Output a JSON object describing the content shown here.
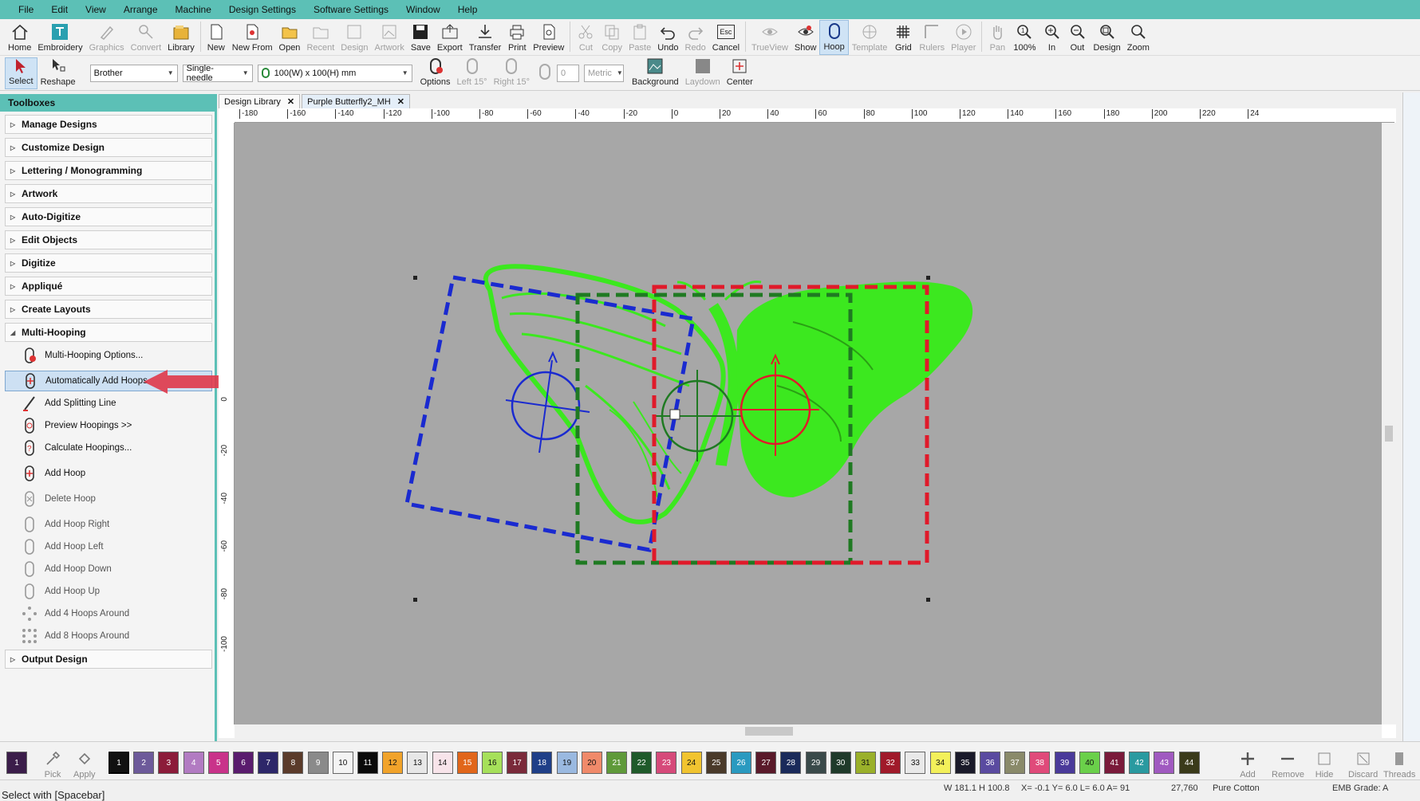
{
  "menu": [
    "File",
    "Edit",
    "View",
    "Arrange",
    "Machine",
    "Design Settings",
    "Software Settings",
    "Window",
    "Help"
  ],
  "toolbar1": {
    "home": "Home",
    "embroidery": "Embroidery",
    "graphics": "Graphics",
    "convert": "Convert",
    "library": "Library",
    "new": "New",
    "new_from": "New From",
    "open": "Open",
    "recent": "Recent",
    "design": "Design",
    "artwork": "Artwork",
    "save": "Save",
    "export": "Export",
    "transfer": "Transfer",
    "print": "Print",
    "preview": "Preview",
    "cut": "Cut",
    "copy": "Copy",
    "paste": "Paste",
    "undo": "Undo",
    "redo": "Redo",
    "cancel": "Cancel",
    "esc": "Esc",
    "trueview": "TrueView",
    "show": "Show",
    "hoop": "Hoop",
    "template": "Template",
    "grid": "Grid",
    "rulers": "Rulers",
    "player": "Player",
    "pan": "Pan",
    "zoom100": "100%",
    "zoom_in": "In",
    "zoom_out": "Out",
    "zoom_design": "Design",
    "zoom": "Zoom"
  },
  "toolbar2": {
    "select": "Select",
    "reshape": "Reshape",
    "machine_brand": "Brother",
    "needle": "Single-needle",
    "hoop_size": "100(W) x 100(H) mm",
    "options": "Options",
    "left15": "Left 15°",
    "right15": "Right 15°",
    "angle_value": "0",
    "units": "Metric",
    "background": "Background",
    "laydown": "Laydown",
    "center": "Center"
  },
  "toolboxes": {
    "title": "Toolboxes",
    "sections": [
      "Manage Designs",
      "Customize Design",
      "Lettering / Monogramming",
      "Artwork",
      "Auto-Digitize",
      "Edit Objects",
      "Digitize",
      "Appliqué",
      "Create Layouts",
      "Multi-Hooping"
    ],
    "multi_hooping_tools": [
      "Multi-Hooping Options...",
      "Automatically Add Hoops",
      "Add Splitting Line",
      "Preview Hoopings >>",
      "Calculate Hoopings...",
      "Add Hoop",
      "Delete Hoop",
      "Add Hoop Right",
      "Add Hoop Left",
      "Add Hoop Down",
      "Add Hoop Up",
      "Add 4 Hoops Around",
      "Add 8 Hoops Around"
    ],
    "output_section": "Output Design"
  },
  "doc_tabs": [
    {
      "label": "Design Library"
    },
    {
      "label": "Purple Butterfly2_MH"
    }
  ],
  "ruler_top_labels": [
    "-180",
    "-160",
    "-140",
    "-120",
    "-100",
    "-80",
    "-60",
    "-40",
    "-20",
    "0",
    "20",
    "40",
    "60",
    "80",
    "100",
    "120",
    "140",
    "160",
    "180",
    "200",
    "220",
    "24"
  ],
  "ruler_left_labels": [
    "0",
    "-20",
    "-40",
    "-60",
    "-80",
    "-100"
  ],
  "palette": {
    "pick": "Pick",
    "apply": "Apply",
    "swatches": [
      {
        "n": "1",
        "c": "#3b1d4a"
      },
      {
        "n": "1",
        "c": "#111111"
      },
      {
        "n": "2",
        "c": "#6d5a9a"
      },
      {
        "n": "3",
        "c": "#8c1c3a"
      },
      {
        "n": "4",
        "c": "#b27bc2"
      },
      {
        "n": "5",
        "c": "#c9338a"
      },
      {
        "n": "6",
        "c": "#5a1c6e"
      },
      {
        "n": "7",
        "c": "#2d2769"
      },
      {
        "n": "8",
        "c": "#5b3b2a"
      },
      {
        "n": "9",
        "c": "#8a8a8a"
      },
      {
        "n": "10",
        "c": "#f4f4f4"
      },
      {
        "n": "11",
        "c": "#0b0b0b"
      },
      {
        "n": "12",
        "c": "#f1a32a"
      },
      {
        "n": "13",
        "c": "#e7e7e7"
      },
      {
        "n": "14",
        "c": "#f8e4ea"
      },
      {
        "n": "15",
        "c": "#e1661a"
      },
      {
        "n": "16",
        "c": "#a6e05a"
      },
      {
        "n": "17",
        "c": "#7a2a3a"
      },
      {
        "n": "18",
        "c": "#1f3f88"
      },
      {
        "n": "19",
        "c": "#9ab9e0"
      },
      {
        "n": "20",
        "c": "#f08a6a"
      },
      {
        "n": "21",
        "c": "#5f9a3a"
      },
      {
        "n": "22",
        "c": "#1f5a2a"
      },
      {
        "n": "23",
        "c": "#d64a7a"
      },
      {
        "n": "24",
        "c": "#f1c430"
      },
      {
        "n": "25",
        "c": "#4a3a2a"
      },
      {
        "n": "26",
        "c": "#2a9ac0"
      },
      {
        "n": "27",
        "c": "#5a1a2a"
      },
      {
        "n": "28",
        "c": "#1a2a5a"
      },
      {
        "n": "29",
        "c": "#3a4a4a"
      },
      {
        "n": "30",
        "c": "#1f3a2a"
      },
      {
        "n": "31",
        "c": "#9ab02a"
      },
      {
        "n": "32",
        "c": "#a01a2a"
      },
      {
        "n": "33",
        "c": "#e9e9e9"
      },
      {
        "n": "34",
        "c": "#f3f05a"
      },
      {
        "n": "35",
        "c": "#1a1a2a"
      },
      {
        "n": "36",
        "c": "#5a4aa0"
      },
      {
        "n": "37",
        "c": "#8a8a6a"
      },
      {
        "n": "38",
        "c": "#e04a7a"
      },
      {
        "n": "39",
        "c": "#4a3a9a"
      },
      {
        "n": "40",
        "c": "#6ad04a"
      },
      {
        "n": "41",
        "c": "#7a1a3a"
      },
      {
        "n": "42",
        "c": "#2a9aa0"
      },
      {
        "n": "43",
        "c": "#a05ac0"
      },
      {
        "n": "44",
        "c": "#3a3a1a"
      }
    ],
    "add": "Add",
    "remove": "Remove",
    "hide": "Hide",
    "discard": "Discard",
    "threads": "Threads"
  },
  "status": {
    "message": "Select with [Spacebar]",
    "size": "W 181.1 H 100.8",
    "coords": "X= -0.1 Y= 6.0 L= 6.0 A= 91",
    "stitches": "27,760",
    "fabric": "Pure Cotton",
    "grade": "EMB Grade: A"
  },
  "colors": {
    "accent": "#5cc0b6",
    "hoop_blue": "#1a2ad0",
    "hoop_green": "#1f7a22",
    "hoop_red": "#e01a2a",
    "butterfly": "#3ce81f",
    "canvas": "#a7a7a7",
    "callout": "#e0394a"
  }
}
